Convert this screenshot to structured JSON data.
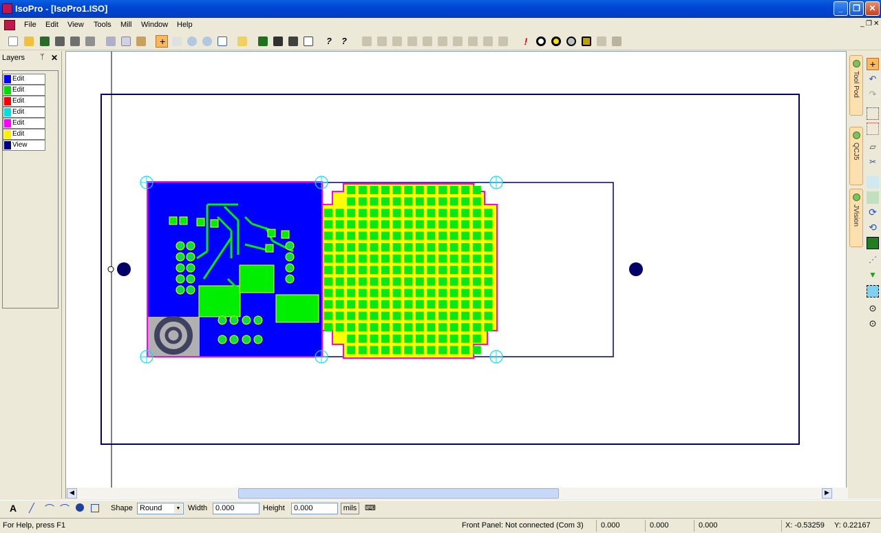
{
  "window": {
    "title": "IsoPro - [IsoPro1.ISO]",
    "min_label": "_",
    "max_label": "❐",
    "close_label": "✕"
  },
  "menu": {
    "items": [
      "File",
      "Edit",
      "View",
      "Tools",
      "Mill",
      "Window",
      "Help"
    ]
  },
  "layers_panel": {
    "title": "Layers",
    "pin_label": "ᛘ",
    "close_label": "✕",
    "rows": [
      {
        "label": "Edit",
        "color": "#0000ff"
      },
      {
        "label": "Edit",
        "color": "#00dd00"
      },
      {
        "label": "Edit",
        "color": "#ff0000"
      },
      {
        "label": "Edit",
        "color": "#00e0e0"
      },
      {
        "label": "Edit",
        "color": "#ff00ff"
      },
      {
        "label": "Edit",
        "color": "#ffee00"
      },
      {
        "label": "View",
        "color": "#000080"
      }
    ]
  },
  "side_tabs": [
    "Tool Pod",
    "QCJ5",
    "JVision"
  ],
  "bottom_toolbar": {
    "shape_label": "Shape",
    "shape_value": "Round",
    "width_label": "Width",
    "width_value": "0.000",
    "height_label": "Height",
    "height_value": "0.000",
    "units_button": "mils"
  },
  "status": {
    "help": "For Help, press F1",
    "front_panel": "Front Panel: Not connected (Com 3)",
    "val1": "0.000",
    "val2": "0.000",
    "val3": "0.000",
    "x": "X: -0.53259",
    "y": "Y: 0.22167"
  },
  "colors": {
    "board_outline": "#000066",
    "copper_blue": "#0000ff",
    "trace_green": "#00ee00",
    "pad_yellow": "#ffff00",
    "outline_magenta": "#ff00ff",
    "fiducial_cyan": "#00e0ff"
  }
}
